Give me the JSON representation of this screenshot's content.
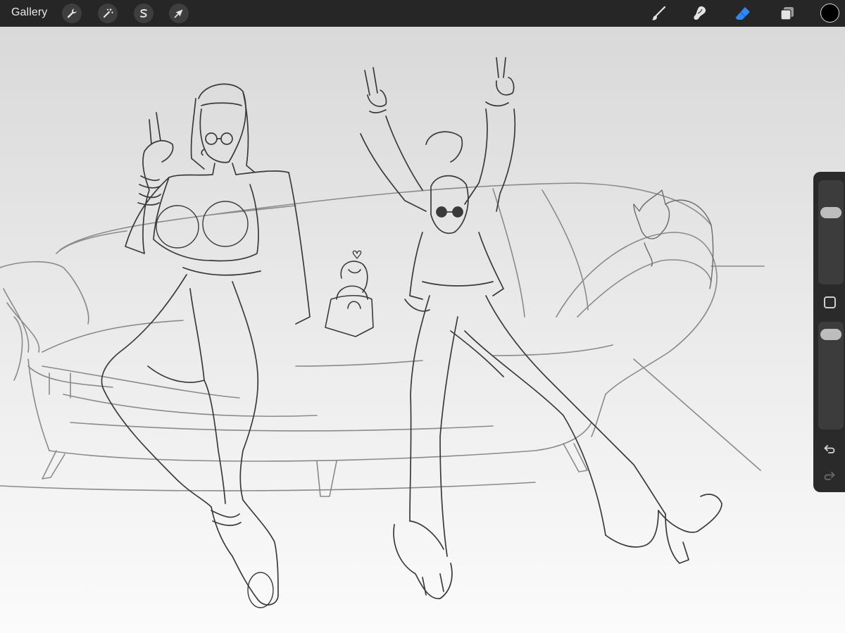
{
  "topbar": {
    "gallery_label": "Gallery",
    "left_tools": [
      {
        "name": "actions-wrench-icon"
      },
      {
        "name": "adjustments-magic-wand-icon"
      },
      {
        "name": "selection-s-icon"
      },
      {
        "name": "transform-arrow-icon"
      }
    ],
    "right_tools": [
      {
        "name": "brush-icon"
      },
      {
        "name": "smudge-icon"
      },
      {
        "name": "eraser-icon",
        "active": true,
        "active_color": "#2f86f6"
      },
      {
        "name": "layers-icon"
      }
    ],
    "current_color": "#000000"
  },
  "sidebar": {
    "brush_size_level": 0.16,
    "opacity_level": 0.05,
    "modify_button": "square-modify-icon",
    "undo_icon": "undo-arrow-icon",
    "redo_icon": "redo-arrow-icon"
  },
  "canvas": {
    "content": "sketch-drawing"
  },
  "colors": {
    "topbar_bg": "#262626",
    "sidebar_bg": "#2a2a2a",
    "accent_eraser": "#2f86f6"
  }
}
